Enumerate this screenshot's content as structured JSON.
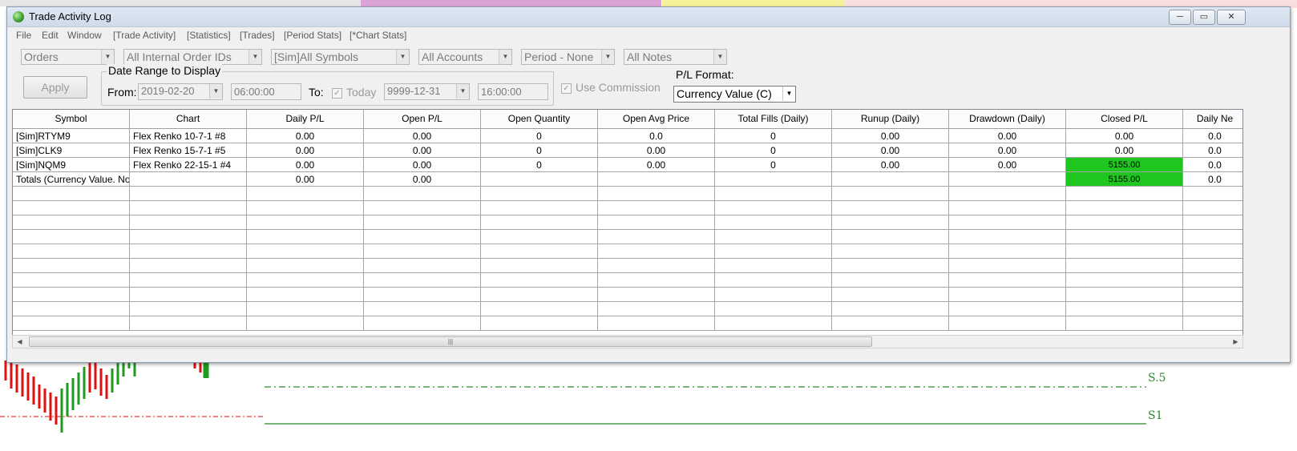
{
  "window": {
    "title": "Trade Activity Log",
    "controls": {
      "minimize": "─",
      "restore": "▭",
      "close": "✕"
    }
  },
  "menu": [
    "File",
    "Edit",
    "Window",
    "[Trade Activity]",
    "[Statistics]",
    "[Trades]",
    "[Period Stats]",
    "[*Chart Stats]"
  ],
  "filters": {
    "view": "Orders",
    "order_ids": "All Internal Order IDs",
    "symbols": "[Sim]All Symbols",
    "accounts": "All Accounts",
    "period": "Period - None",
    "notes": "All Notes"
  },
  "apply_label": "Apply",
  "date_range": {
    "legend": "Date Range to Display",
    "from_label": "From:",
    "from_date": "2019-02-20",
    "from_time": "06:00:00",
    "to_label": "To:",
    "today_label": "Today",
    "today_checked": true,
    "to_date": "9999-12-31",
    "to_time": "16:00:00"
  },
  "use_commission_label": "Use Commission",
  "pl_format": {
    "label": "P/L Format:",
    "value": "Currency Value (C)"
  },
  "grid": {
    "columns": [
      "Symbol",
      "Chart",
      "Daily P/L",
      "Open P/L",
      "Open Quantity",
      "Open Avg Price",
      "Total Fills (Daily)",
      "Runup (Daily)",
      "Drawdown (Daily)",
      "Closed P/L",
      "Daily Ne"
    ],
    "rows": [
      [
        "[Sim]RTYM9",
        "Flex Renko 10-7-1  #8",
        "0.00",
        "0.00",
        "0",
        "0.0",
        "0",
        "0.00",
        "0.00",
        "0.00",
        "0.0"
      ],
      [
        "[Sim]CLK9",
        "Flex Renko 15-7-1  #5",
        "0.00",
        "0.00",
        "0",
        "0.00",
        "0",
        "0.00",
        "0.00",
        "0.00",
        "0.0"
      ],
      [
        "[Sim]NQM9",
        "Flex Renko 22-15-1  #4",
        "0.00",
        "0.00",
        "0",
        "0.00",
        "0",
        "0.00",
        "0.00",
        "5155.00",
        "0.0"
      ],
      [
        "Totals (Currency Value. Non",
        "",
        "0.00",
        "0.00",
        "",
        "",
        "",
        "",
        "",
        "5155.00",
        "0.0"
      ]
    ],
    "highlight_color": "#1fc61f"
  },
  "chart_levels": {
    "s5": "S.5",
    "s1": "S1"
  },
  "colors": {
    "up_bar": "#1e9a1e",
    "down_bar": "#e01010",
    "s_level": "#2c8c2c"
  }
}
